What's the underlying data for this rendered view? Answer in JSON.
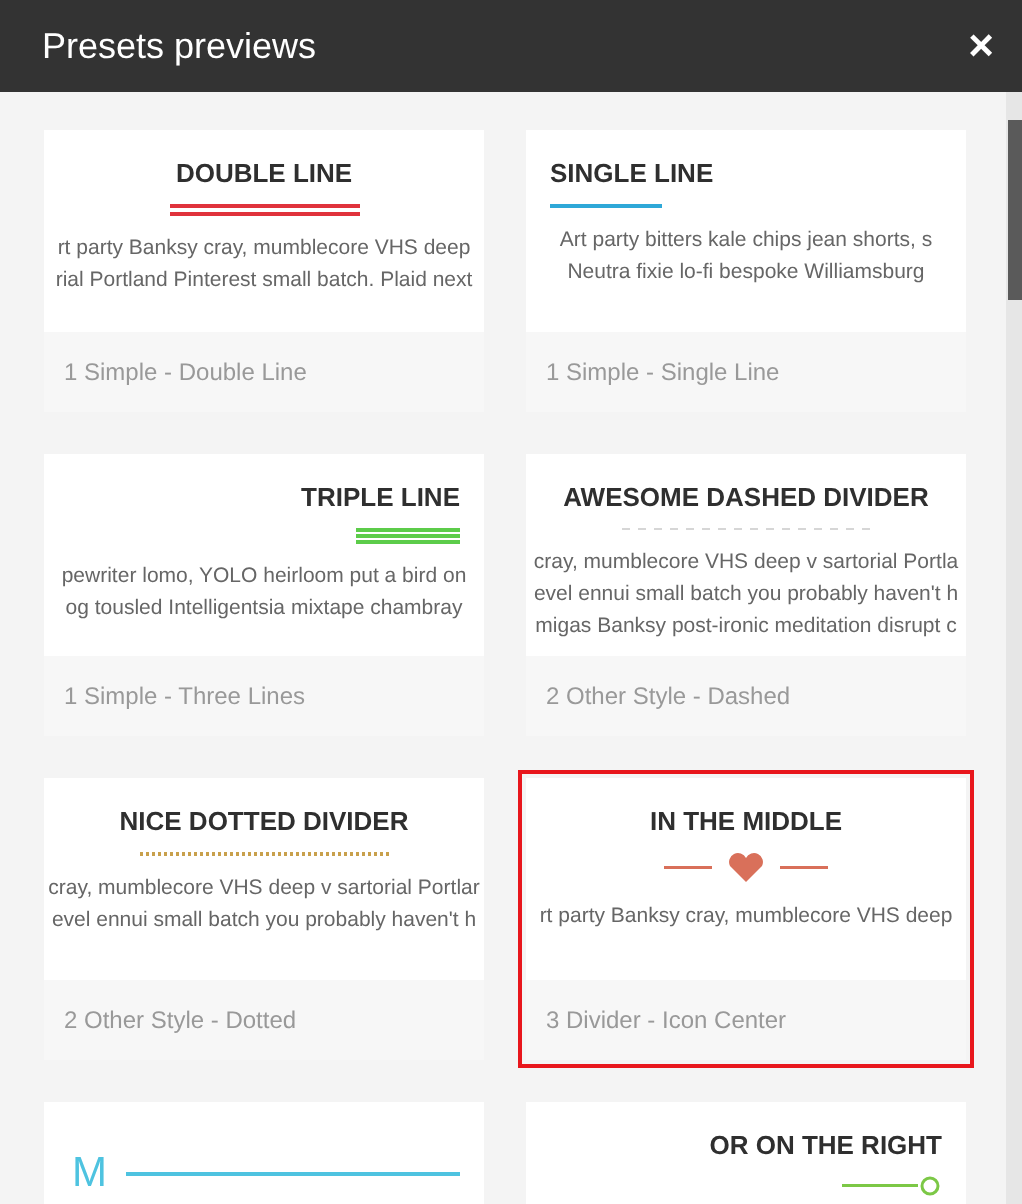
{
  "window": {
    "title": "Presets previews",
    "close": "×"
  },
  "presets": [
    {
      "title": "DOUBLE LINE",
      "divider": {
        "kind": "double",
        "color": "#e0323c"
      },
      "preview": [
        "rt party Banksy cray, mumblecore VHS deep",
        "rial Portland Pinterest small batch. Plaid next"
      ],
      "caption": "1 Simple - Double Line",
      "selected": false
    },
    {
      "title": "SINGLE LINE",
      "divider": {
        "kind": "single",
        "color": "#2ea8d8"
      },
      "preview": [
        "Art party bitters kale chips jean shorts, s",
        "Neutra fixie lo-fi bespoke Williamsburg"
      ],
      "caption": "1 Simple - Single Line",
      "selected": false
    },
    {
      "title": "TRIPLE LINE",
      "divider": {
        "kind": "triple",
        "color": "#5ccc4a"
      },
      "preview": [
        "pewriter lomo, YOLO heirloom put a bird on",
        "og tousled Intelligentsia mixtape chambray"
      ],
      "caption": "1 Simple - Three Lines",
      "selected": false
    },
    {
      "title": "AWESOME DASHED DIVIDER",
      "divider": {
        "kind": "dashed",
        "color": "#d6d6d6"
      },
      "preview": [
        "cray, mumblecore VHS deep v sartorial Portla",
        "evel ennui small batch you probably haven't h",
        "migas Banksy post-ironic meditation disrupt c"
      ],
      "caption": "2 Other Style - Dashed",
      "selected": false
    },
    {
      "title": "NICE DOTTED DIVIDER",
      "divider": {
        "kind": "dotted",
        "color": "#c8a04c"
      },
      "preview": [
        "cray, mumblecore VHS deep v sartorial Portlar",
        "evel ennui small batch you probably haven't h"
      ],
      "caption": "2 Other Style - Dotted",
      "selected": false
    },
    {
      "title": "IN THE MIDDLE",
      "divider": {
        "kind": "heart",
        "color": "#d9705a"
      },
      "preview": [
        "rt party Banksy cray, mumblecore VHS deep"
      ],
      "caption": "3 Divider - Icon Center",
      "selected": true
    },
    {
      "divider": {
        "kind": "letter",
        "color": "#4ec3e0",
        "letter": "M"
      }
    },
    {
      "title": "OR ON THE RIGHT",
      "divider": {
        "kind": "circle",
        "color": "#7cc846"
      }
    }
  ]
}
